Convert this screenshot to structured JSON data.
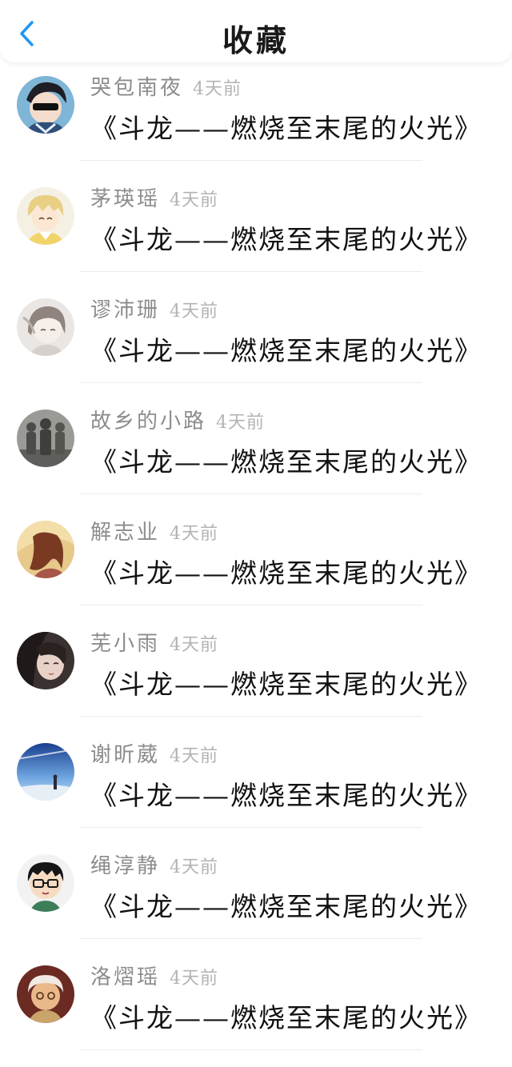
{
  "header": {
    "title": "收藏",
    "back_icon": "chevron-left-icon",
    "accent_color": "#2196f3"
  },
  "items": [
    {
      "username": "哭包南夜",
      "time": "4天前",
      "title": "《斗龙——燃烧至末尾的火光》",
      "avatar": "anime-boy-sunglasses"
    },
    {
      "username": "茅瑛瑶",
      "time": "4天前",
      "title": "《斗龙——燃烧至末尾的火光》",
      "avatar": "anime-blonde-boy"
    },
    {
      "username": "谬沛珊",
      "time": "4天前",
      "title": "《斗龙——燃烧至末尾的火光》",
      "avatar": "anime-girl-sketch"
    },
    {
      "username": "故乡的小路",
      "time": "4天前",
      "title": "《斗龙——燃烧至末尾的火光》",
      "avatar": "stone-statues"
    },
    {
      "username": "解志业",
      "time": "4天前",
      "title": "《斗龙——燃烧至末尾的火光》",
      "avatar": "girl-warm-light"
    },
    {
      "username": "芜小雨",
      "time": "4天前",
      "title": "《斗龙——燃烧至末尾的火光》",
      "avatar": "girl-portrait"
    },
    {
      "username": "谢昕葳",
      "time": "4天前",
      "title": "《斗龙——燃烧至末尾的火光》",
      "avatar": "blue-sky-person"
    },
    {
      "username": "绳淳静",
      "time": "4天前",
      "title": "《斗龙——燃烧至末尾的火光》",
      "avatar": "cartoon-glasses-boy"
    },
    {
      "username": "洛熠瑶",
      "time": "4天前",
      "title": "《斗龙——燃烧至末尾的火光》",
      "avatar": "old-lady"
    }
  ]
}
